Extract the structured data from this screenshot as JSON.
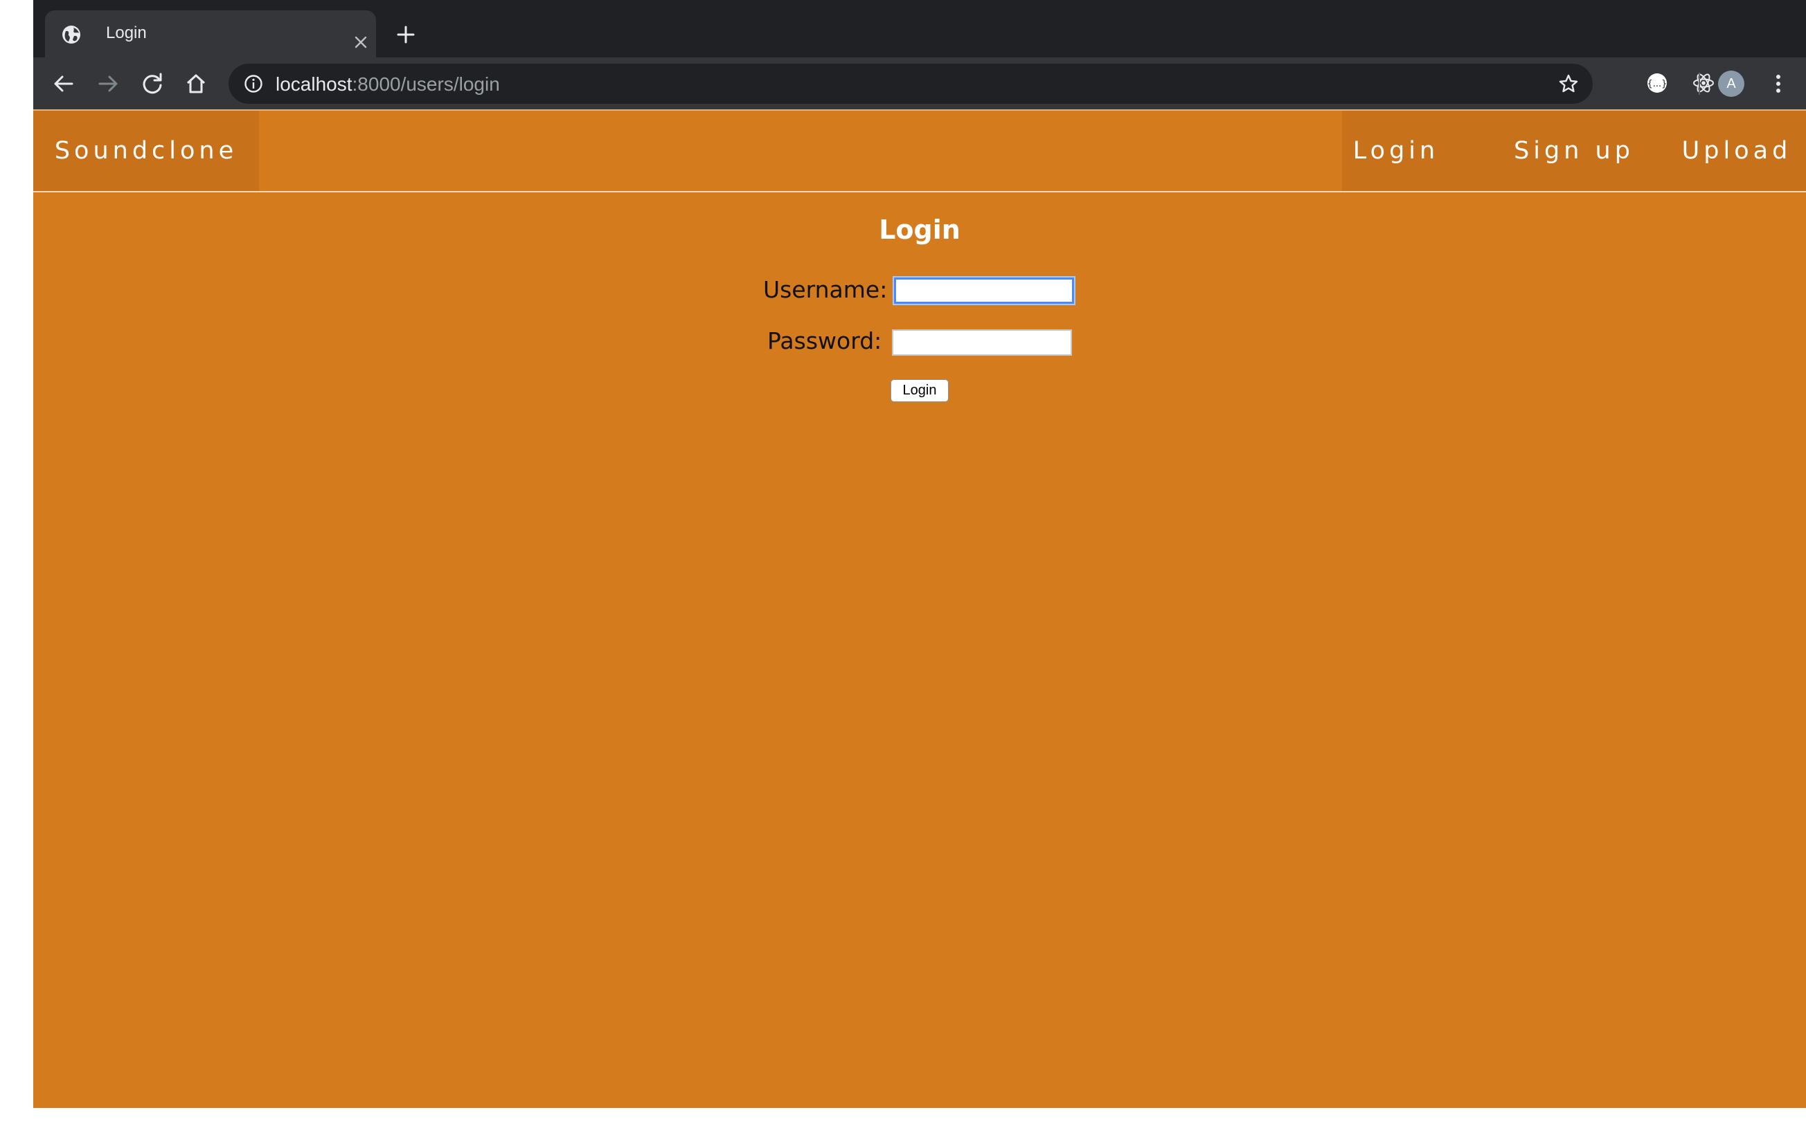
{
  "browser": {
    "tab_title": "Login",
    "url_host": "localhost",
    "url_path": ":8000/users/login",
    "avatar_letter": "A",
    "icons": [
      "globe-icon",
      "close-icon",
      "plus-icon",
      "back-arrow-icon",
      "forward-arrow-icon",
      "reload-icon",
      "home-icon",
      "info-icon",
      "star-icon",
      "extension-icon",
      "react-devtools-icon",
      "more-vert-icon"
    ]
  },
  "navbar": {
    "brand": "Soundclone",
    "items": [
      {
        "label": "Login"
      },
      {
        "label": "Sign up"
      },
      {
        "label": "Upload"
      }
    ]
  },
  "form": {
    "title": "Login",
    "username_label": "Username:",
    "username_value": "",
    "password_label": "Password:",
    "password_value": "",
    "submit_label": "Login"
  },
  "colors": {
    "page_background": "#d47b1e",
    "nav_item_background": "#c8711b",
    "focus_ring": "#4c8bf5"
  }
}
